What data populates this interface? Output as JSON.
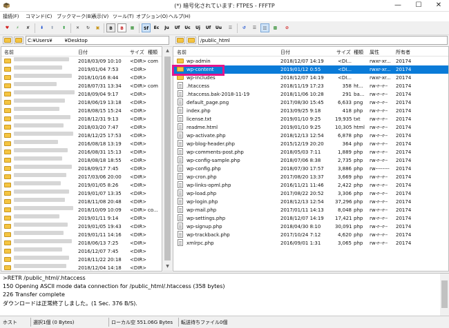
{
  "window": {
    "title": "(*) 暗号化されています: FTPES - FFFTP"
  },
  "menu": [
    "接続(F)",
    "コマンド(C)",
    "ブックマーク(B)",
    "表示(V)",
    "ツール(T)",
    "オプション(O)",
    "ヘルプ(H)"
  ],
  "toolbar": [
    "Sf",
    "Ec",
    "Ju",
    "Uf",
    "Uc",
    "Uj",
    "Uf",
    "Uu"
  ],
  "left": {
    "path": "C:¥Users¥        ¥Desktop",
    "headers": {
      "name": "名前",
      "date": "日付",
      "size": "サイズ",
      "type": "種類"
    },
    "rows": [
      {
        "date": "2018/03/09 10:10",
        "size": "<DIR>",
        "type": "com"
      },
      {
        "date": "2019/01/04 7:53",
        "size": "<DIR>",
        "type": ""
      },
      {
        "date": "2018/10/16 8:44",
        "size": "<DIR>",
        "type": ""
      },
      {
        "date": "2018/07/31 13:34",
        "size": "<DIR>",
        "type": "com"
      },
      {
        "date": "2018/09/04 9:17",
        "size": "<DIR>",
        "type": ""
      },
      {
        "date": "2018/06/19 13:18",
        "size": "<DIR>",
        "type": ""
      },
      {
        "date": "2018/08/15 15:24",
        "size": "<DIR>",
        "type": ""
      },
      {
        "date": "2018/12/31 9:13",
        "size": "<DIR>",
        "type": ""
      },
      {
        "date": "2018/03/20 7:47",
        "size": "<DIR>",
        "type": ""
      },
      {
        "date": "2018/12/25 17:53",
        "size": "<DIR>",
        "type": ""
      },
      {
        "date": "2016/08/18 13:19",
        "size": "<DIR>",
        "type": ""
      },
      {
        "date": "2016/08/31 15:13",
        "size": "<DIR>",
        "type": ""
      },
      {
        "date": "2018/08/18 18:55",
        "size": "<DIR>",
        "type": ""
      },
      {
        "date": "2018/09/17 7:45",
        "size": "<DIR>",
        "type": ""
      },
      {
        "date": "2017/03/06 20:00",
        "size": "<DIR>",
        "type": ""
      },
      {
        "date": "2019/01/05 8:26",
        "size": "<DIR>",
        "type": ""
      },
      {
        "date": "2019/01/07 13:35",
        "size": "<DIR>",
        "type": ""
      },
      {
        "date": "2018/11/08 20:48",
        "size": "<DIR>",
        "type": ""
      },
      {
        "date": "2018/10/09 10:09",
        "size": "<DIR>",
        "type": "co..."
      },
      {
        "date": "2019/01/11 9:14",
        "size": "<DIR>",
        "type": ""
      },
      {
        "date": "2019/01/05 19:43",
        "size": "<DIR>",
        "type": ""
      },
      {
        "date": "2019/01/11 14:16",
        "size": "<DIR>",
        "type": ""
      },
      {
        "date": "2018/06/13 7:25",
        "size": "<DIR>",
        "type": ""
      },
      {
        "date": "2016/12/07 7:45",
        "size": "<DIR>",
        "type": ""
      },
      {
        "date": "2018/11/22 20:18",
        "size": "<DIR>",
        "type": ""
      },
      {
        "date": "2018/12/04 14:18",
        "size": "<DIR>",
        "type": ""
      }
    ]
  },
  "right": {
    "path": "/public_html",
    "headers": {
      "name": "名前",
      "date": "日付",
      "size": "サイズ",
      "type": "種類",
      "attr": "属性",
      "owner": "所有者"
    },
    "rows": [
      {
        "kind": "folder",
        "name": "wp-admin",
        "date": "2018/12/07 14:19",
        "size": "<DI...",
        "type": "",
        "attr": "rwxr-xr...",
        "owner": "20174"
      },
      {
        "kind": "folder",
        "name": "wp-content",
        "date": "2019/01/12 0:55",
        "size": "<DI...",
        "type": "",
        "attr": "rwxr-xr...",
        "owner": "20174"
      },
      {
        "kind": "folder",
        "name": "wp-includes",
        "date": "2018/12/07 14:19",
        "size": "<DI...",
        "type": "",
        "attr": "rwxr-xr...",
        "owner": "20174"
      },
      {
        "kind": "file",
        "name": ".htaccess",
        "date": "2018/11/19 17:23",
        "size": "358",
        "type": "ht...",
        "attr": "rw-r--r--",
        "owner": "20174"
      },
      {
        "kind": "file",
        "name": ".htaccess.bak-2018-11-19",
        "date": "2018/11/06 10:28",
        "size": "291",
        "type": "ba...",
        "attr": "rw-r--r--",
        "owner": "20174"
      },
      {
        "kind": "file",
        "name": "default_page.png",
        "date": "2017/08/30 15:45",
        "size": "6,633",
        "type": "png",
        "attr": "rw-r--r--",
        "owner": "20174"
      },
      {
        "kind": "file",
        "name": "index.php",
        "date": "2013/09/25 9:18",
        "size": "418",
        "type": "php",
        "attr": "rw-r--r--",
        "owner": "20174"
      },
      {
        "kind": "file",
        "name": "license.txt",
        "date": "2019/01/10 9:25",
        "size": "19,935",
        "type": "txt",
        "attr": "rw-r--r--",
        "owner": "20174"
      },
      {
        "kind": "file",
        "name": "readme.html",
        "date": "2019/01/10 9:25",
        "size": "10,305",
        "type": "html",
        "attr": "rw-r--r--",
        "owner": "20174"
      },
      {
        "kind": "file",
        "name": "wp-activate.php",
        "date": "2018/12/13 12:54",
        "size": "6,878",
        "type": "php",
        "attr": "rw-r--r--",
        "owner": "20174"
      },
      {
        "kind": "file",
        "name": "wp-blog-header.php",
        "date": "2015/12/19 20:20",
        "size": "364",
        "type": "php",
        "attr": "rw-r--r--",
        "owner": "20174"
      },
      {
        "kind": "file",
        "name": "wp-comments-post.php",
        "date": "2018/05/03 7:11",
        "size": "1,889",
        "type": "php",
        "attr": "rw-r--r--",
        "owner": "20174"
      },
      {
        "kind": "file",
        "name": "wp-config-sample.php",
        "date": "2018/07/06 8:38",
        "size": "2,735",
        "type": "php",
        "attr": "rw-r--r--",
        "owner": "20174"
      },
      {
        "kind": "file",
        "name": "wp-config.php",
        "date": "2018/07/30 17:57",
        "size": "3,886",
        "type": "php",
        "attr": "rw--------",
        "owner": "20174"
      },
      {
        "kind": "file",
        "name": "wp-cron.php",
        "date": "2017/08/20 13:37",
        "size": "3,669",
        "type": "php",
        "attr": "rw-r--r--",
        "owner": "20174"
      },
      {
        "kind": "file",
        "name": "wp-links-opml.php",
        "date": "2016/11/21 11:46",
        "size": "2,422",
        "type": "php",
        "attr": "rw-r--r--",
        "owner": "20174"
      },
      {
        "kind": "file",
        "name": "wp-load.php",
        "date": "2017/08/22 20:52",
        "size": "3,306",
        "type": "php",
        "attr": "rw-r--r--",
        "owner": "20174"
      },
      {
        "kind": "file",
        "name": "wp-login.php",
        "date": "2018/12/13 12:54",
        "size": "37,296",
        "type": "php",
        "attr": "rw-r--r--",
        "owner": "20174"
      },
      {
        "kind": "file",
        "name": "wp-mail.php",
        "date": "2017/01/11 14:13",
        "size": "8,048",
        "type": "php",
        "attr": "rw-r--r--",
        "owner": "20174"
      },
      {
        "kind": "file",
        "name": "wp-settings.php",
        "date": "2018/12/07 14:19",
        "size": "17,421",
        "type": "php",
        "attr": "rw-r--r--",
        "owner": "20174"
      },
      {
        "kind": "file",
        "name": "wp-signup.php",
        "date": "2018/04/30 8:10",
        "size": "30,091",
        "type": "php",
        "attr": "rw-r--r--",
        "owner": "20174"
      },
      {
        "kind": "file",
        "name": "wp-trackback.php",
        "date": "2017/10/24 7:12",
        "size": "4,620",
        "type": "php",
        "attr": "rw-r--r--",
        "owner": "20174"
      },
      {
        "kind": "file",
        "name": "xmlrpc.php",
        "date": "2016/09/01 1:31",
        "size": "3,065",
        "type": "php",
        "attr": "rw-r--r--",
        "owner": "20174"
      }
    ],
    "selected_index": 1
  },
  "log": [
    ">RETR /public_html/.htaccess",
    "150 Opening ASCII mode data connection for /public_html/.htaccess (358 bytes)",
    "226 Transfer complete",
    "ダウンロードは正常終了しました。(1 Sec. 376 B/S)."
  ],
  "status": {
    "host": "ホスト",
    "selection": "選択1個 (0 Bytes)",
    "local_free": "ローカル空 551.06G Bytes",
    "queue": "転送待ちファイル0個"
  }
}
